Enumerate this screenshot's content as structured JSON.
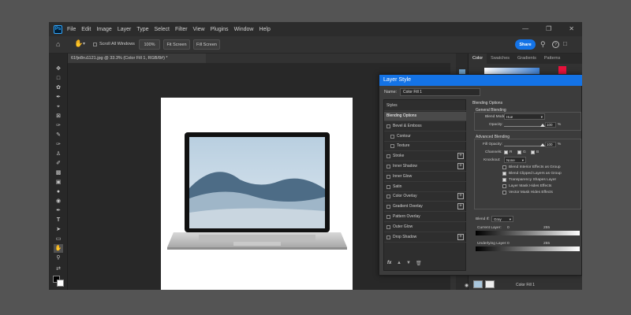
{
  "menubar": {
    "logo": "Ps",
    "items": [
      "File",
      "Edit",
      "Image",
      "Layer",
      "Type",
      "Select",
      "Filter",
      "View",
      "Plugins",
      "Window",
      "Help"
    ]
  },
  "optionsbar": {
    "scroll_all": "Scroll All Windows",
    "zoom_100": "100%",
    "fit_screen": "Fit Screen",
    "fill_screen": "Fill Screen",
    "share": "Share"
  },
  "document": {
    "tab": "61fje8ru1121.jpg @ 33.3% (Color Fill 1, RGB/8#) *"
  },
  "panels": {
    "tabs": [
      "Color",
      "Swatches",
      "Gradients",
      "Patterns"
    ],
    "layer_name": "Color Fill 1"
  },
  "dialog": {
    "title": "Layer Style",
    "name_label": "Name:",
    "name_value": "Color Fill 1",
    "styles_header": "Styles",
    "styles": [
      {
        "label": "Blending Options",
        "checkbox": false,
        "plus": false,
        "selected": true
      },
      {
        "label": "Bevel & Emboss",
        "checkbox": true,
        "plus": false,
        "selected": false
      },
      {
        "label": "Contour",
        "checkbox": true,
        "plus": false,
        "selected": false,
        "indent": true
      },
      {
        "label": "Texture",
        "checkbox": true,
        "plus": false,
        "selected": false,
        "indent": true
      },
      {
        "label": "Stroke",
        "checkbox": true,
        "plus": true,
        "selected": false
      },
      {
        "label": "Inner Shadow",
        "checkbox": true,
        "plus": true,
        "selected": false
      },
      {
        "label": "Inner Glow",
        "checkbox": true,
        "plus": false,
        "selected": false
      },
      {
        "label": "Satin",
        "checkbox": true,
        "plus": false,
        "selected": false
      },
      {
        "label": "Color Overlay",
        "checkbox": true,
        "plus": true,
        "selected": false
      },
      {
        "label": "Gradient Overlay",
        "checkbox": true,
        "plus": true,
        "selected": false
      },
      {
        "label": "Pattern Overlay",
        "checkbox": true,
        "plus": false,
        "selected": false
      },
      {
        "label": "Outer Glow",
        "checkbox": true,
        "plus": false,
        "selected": false
      },
      {
        "label": "Drop Shadow",
        "checkbox": true,
        "plus": true,
        "selected": false
      }
    ],
    "fx_label": "fx",
    "blending": {
      "title": "Blending Options",
      "general": "General Blending",
      "blend_mode_label": "Blend Mode:",
      "blend_mode_value": "Hue",
      "opacity_label": "Opacity:",
      "opacity_value": "100",
      "opacity_unit": "%",
      "advanced": "Advanced Blending",
      "fill_opacity_label": "Fill Opacity:",
      "fill_opacity_value": "100",
      "fill_opacity_unit": "%",
      "channels_label": "Channels:",
      "channels": [
        "R",
        "G",
        "B"
      ],
      "knockout_label": "Knockout:",
      "knockout_value": "None",
      "checks": [
        {
          "label": "Blend Interior Effects as Group",
          "on": false
        },
        {
          "label": "Blend Clipped Layers as Group",
          "on": true
        },
        {
          "label": "Transparency Shapes Layer",
          "on": true
        },
        {
          "label": "Layer Mask Hides Effects",
          "on": false
        },
        {
          "label": "Vector Mask Hides Effects",
          "on": false
        }
      ],
      "blend_if_label": "Blend If:",
      "blend_if_value": "Gray",
      "current_layer_label": "Current Layer:",
      "underlying_layer_label": "Underlying Layer:",
      "min": "0",
      "max": "255"
    }
  },
  "colors": {
    "accent": "#1473e6",
    "red_swatch": "#e8123c"
  }
}
